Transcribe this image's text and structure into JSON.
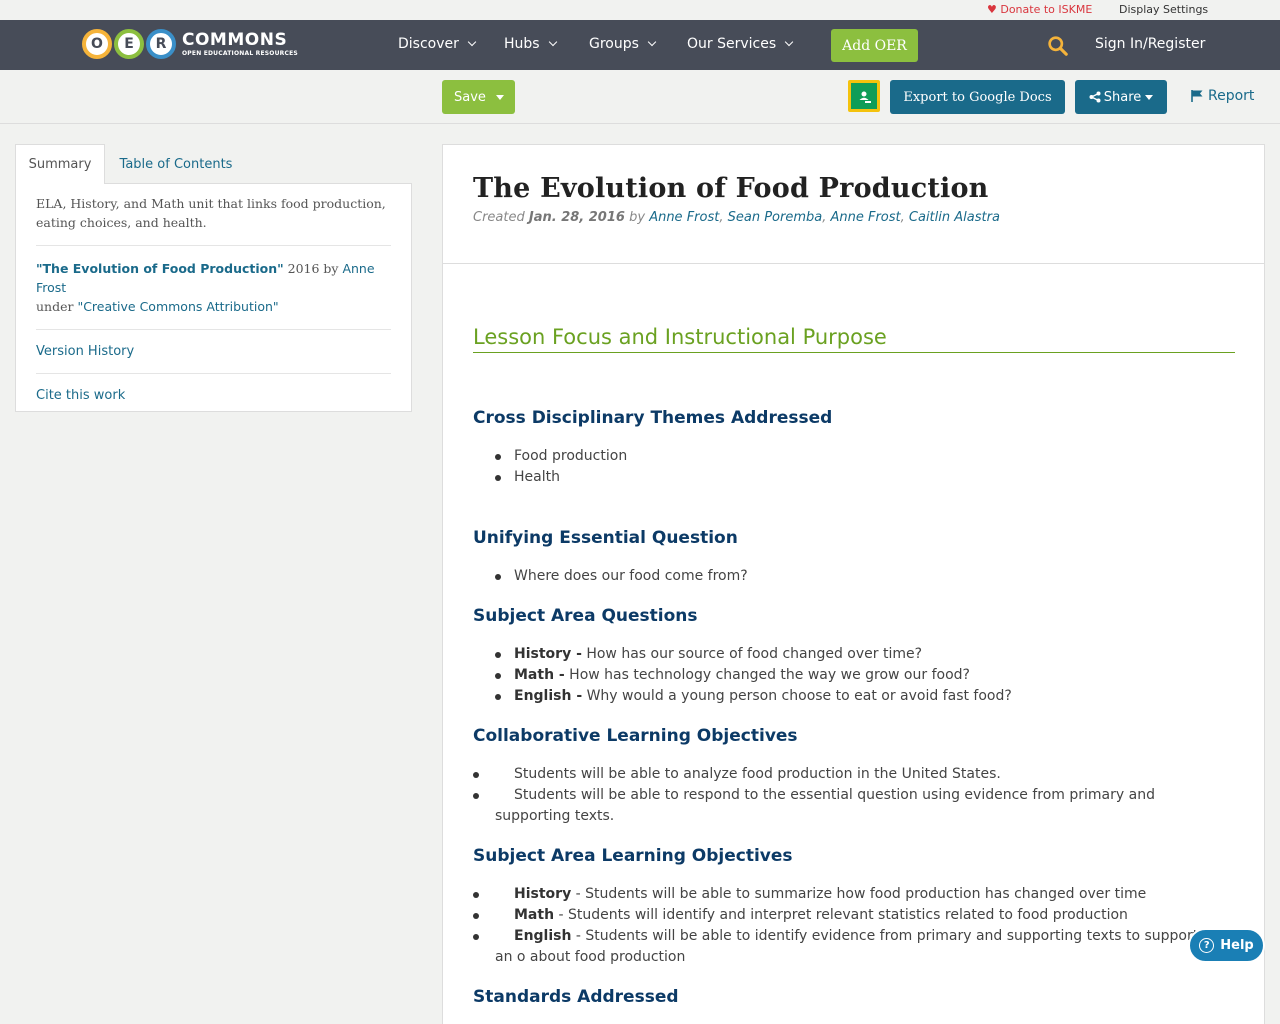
{
  "utility": {
    "donate": "Donate to ISKME",
    "display_settings": "Display Settings"
  },
  "nav": {
    "logo_letters": [
      "O",
      "E",
      "R"
    ],
    "logo_title": "COMMONS",
    "logo_subtitle": "OPEN EDUCATIONAL RESOURCES",
    "items": [
      {
        "label": "Discover"
      },
      {
        "label": "Hubs"
      },
      {
        "label": "Groups"
      },
      {
        "label": "Our Services"
      }
    ],
    "add_oer": "Add OER",
    "sign_in": "Sign In/Register"
  },
  "toolbar": {
    "save": "Save",
    "export": "Export to Google Docs",
    "share": "Share",
    "report": "Report"
  },
  "sidebar": {
    "tabs": [
      "Summary",
      "Table of Contents"
    ],
    "description": "ELA, History, and Math unit that links food production, eating choices, and health.",
    "attribution": {
      "title": "\"The Evolution of Food Production\"",
      "year_by": " 2016 by ",
      "author": "Anne Frost",
      "under": "under ",
      "license": "\"Creative Commons Attribution\""
    },
    "version_history": "Version History",
    "cite": "Cite this work"
  },
  "main": {
    "title": "The Evolution of Food Production",
    "created_label": "Created",
    "date": "Jan. 28, 2016",
    "by": "by",
    "authors": [
      "Anne Frost",
      "Sean Poremba",
      "Anne Frost",
      "Caitlin Alastra"
    ],
    "section_title": "Lesson Focus and Instructional Purpose",
    "sections": [
      {
        "heading": "Cross Disciplinary Themes Addressed",
        "items": [
          {
            "bold": "",
            "text": "Food production"
          },
          {
            "bold": "",
            "text": "Health"
          }
        ]
      },
      {
        "heading": "Unifying Essential Question",
        "items": [
          {
            "bold": "",
            "text": "Where does our food come from?"
          }
        ]
      },
      {
        "heading": "Subject Area Questions",
        "items": [
          {
            "bold": "History  -",
            "text": " How has our source of food changed over time?"
          },
          {
            "bold": "Math -",
            "text": " How has technology changed the way we grow our food?"
          },
          {
            "bold": "English -",
            "text": " Why would a young person choose to eat or avoid fast food?"
          }
        ]
      },
      {
        "heading": "Collaborative Learning Objectives",
        "items": [
          {
            "bold": "",
            "text": "Students will be able to analyze food production in the United States."
          },
          {
            "bold": "",
            "text": "Students will be able to respond to the essential question using evidence from primary and supporting texts."
          }
        ]
      },
      {
        "heading": "Subject Area Learning Objectives",
        "items": [
          {
            "bold": "History",
            "text": " -  Students will be able to summarize how food production has changed over time"
          },
          {
            "bold": "Math",
            "text": " - Students will identify and interpret relevant statistics related to food production"
          },
          {
            "bold": "English",
            "text": " - Students will be able to identify evidence from primary and supporting texts to support an o about food production"
          }
        ]
      },
      {
        "heading": "Standards Addressed",
        "items": []
      }
    ]
  },
  "help": "Help"
}
